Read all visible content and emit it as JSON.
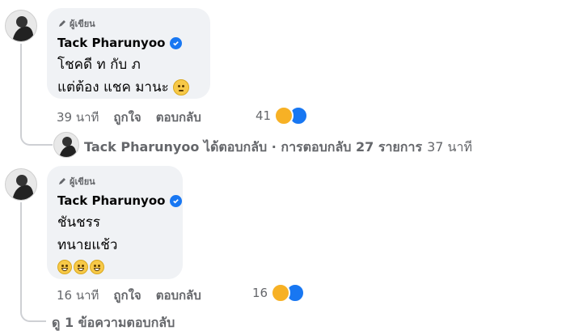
{
  "comments": [
    {
      "badge": "ผู้เขียน",
      "author": "Tack Pharunyoo",
      "lines": [
        "โชคดี ท กับ ภ",
        "แต่ต้อง แชค มานะ"
      ],
      "time": "39 นาที",
      "like_label": "ถูกใจ",
      "reply_label": "ตอบกลับ",
      "reaction_count": "41"
    },
    {
      "badge": "ผู้เขียน",
      "author": "Tack Pharunyoo",
      "lines": [
        "ชันชรร",
        "ทนายแช้ว"
      ],
      "time": "16 นาที",
      "like_label": "ถูกใจ",
      "reply_label": "ตอบกลับ",
      "reaction_count": "16"
    }
  ],
  "reply_summary": {
    "text": "Tack Pharunyoo ได้ตอบกลับ · การตอบกลับ 27 รายการ",
    "time": "37 นาที"
  },
  "view_replies": "ดู 1 ข้อความตอบกลับ",
  "colors": {
    "bubble": "#f0f2f5",
    "secondary_text": "#65676b",
    "verified": "#1877f2",
    "haha": "#f7b125"
  },
  "icons": [
    "pencil-icon",
    "verified-icon",
    "haha-reaction-icon",
    "like-reaction-icon",
    "sad-emoji-icon",
    "grin-emoji-icon"
  ]
}
